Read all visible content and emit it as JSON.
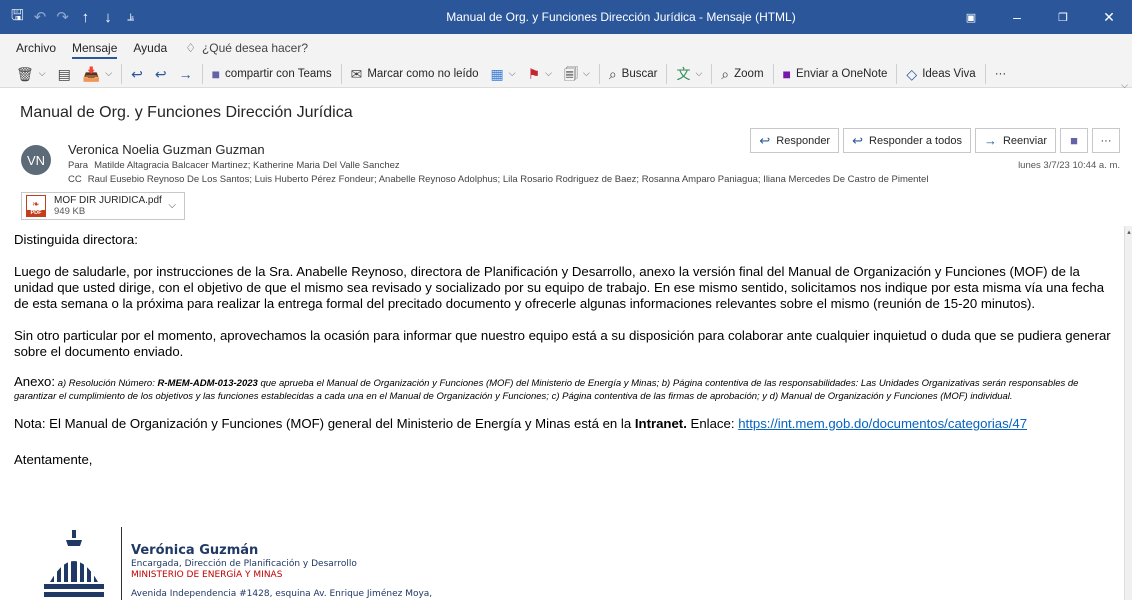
{
  "window": {
    "title": "Manual de Org. y Funciones Dirección Jurídica  -  Mensaje (HTML)"
  },
  "ribbon": {
    "tabs": [
      "Archivo",
      "Mensaje",
      "Ayuda"
    ],
    "tell_me": "¿Qué desea hacer?"
  },
  "toolbar": {
    "teams": "compartir con Teams",
    "mark_unread": "Marcar como no leído",
    "search": "Buscar",
    "zoom": "Zoom",
    "onenote": "Enviar a OneNote",
    "viva": "Ideas Viva",
    "more": "···"
  },
  "message": {
    "subject": "Manual de Org. y Funciones Dirección Jurídica",
    "avatar_initials": "VN",
    "sender": "Veronica Noelia Guzman Guzman",
    "to_label": "Para",
    "to": "Matilde Altagracia Balcacer Martinez; Katherine Maria Del Valle Sanchez",
    "cc_label": "CC",
    "cc": "Raul Eusebio Reynoso De Los Santos; Luis Huberto Pérez Fondeur; Anabelle Reynoso Adolphus; Lila Rosario Rodriguez de Baez; Rosanna Amparo Paniagua; Iliana Mercedes De Castro de Pimentel",
    "date": "lunes 3/7/23 10:44 a. m.",
    "actions": {
      "reply": "Responder",
      "reply_all": "Responder a todos",
      "forward": "Reenviar",
      "more": "···"
    },
    "attachment": {
      "name": "MOF DIR JURIDICA.pdf",
      "size": "949 KB"
    }
  },
  "body": {
    "greeting": "Distinguida directora:",
    "p1": "Luego de saludarle, por instrucciones de la Sra. Anabelle Reynoso, directora de Planificación y Desarrollo, anexo la versión final del Manual de Organización y Funciones (MOF) de la unidad que usted dirige, con el objetivo de que el mismo sea revisado y socializado por su equipo de trabajo. En ese mismo sentido, solicitamos nos indique por esta misma vía una fecha de esta semana o la próxima para realizar la entrega formal del precitado documento y ofrecerle algunas informaciones relevantes sobre el mismo (reunión de 15-20 minutos).",
    "p2": "Sin otro particular por el momento, aprovechamos la ocasión para informar que nuestro equipo está a su disposición para colaborar ante cualquier inquietud o duda que se pudiera generar sobre el documento enviado.",
    "anexo_label": "Anexo:",
    "anexo_a": " a) Resolución Número: ",
    "anexo_num": "R-MEM-ADM-013-2023",
    "anexo_rest": " que aprueba el Manual de Organización y Funciones (MOF) del Ministerio de Energía y Minas; b) Página contentiva de las responsabilidades: Las Unidades Organizativas serán responsables de garantizar el cumplimiento de los objetivos y las funciones establecidas a cada una en el Manual de Organización y Funciones; c) Página contentiva de las firmas de aprobación; y d) Manual de Organización y Funciones (MOF) individual.",
    "nota_pre": "Nota: El Manual de Organización y Funciones (MOF) general del Ministerio de Energía y Minas está en la ",
    "nota_bold": "Intranet.",
    "nota_mid": " Enlace: ",
    "nota_link": "https://int.mem.gob.do/documentos/categorias/47",
    "closing": "Atentamente,"
  },
  "signature": {
    "name": "Verónica Guzmán",
    "role": "Encargada, Dirección de Planificación y Desarrollo",
    "org": "MINISTERIO DE ENERGÍA Y MINAS",
    "address": "Avenida Independencia #1428, esquina Av. Enrique Jiménez Moya,"
  },
  "colors": {
    "titlebar": "#2b579a",
    "link": "#0563c1",
    "signature_blue": "#1f3864",
    "signature_red": "#c00000"
  }
}
